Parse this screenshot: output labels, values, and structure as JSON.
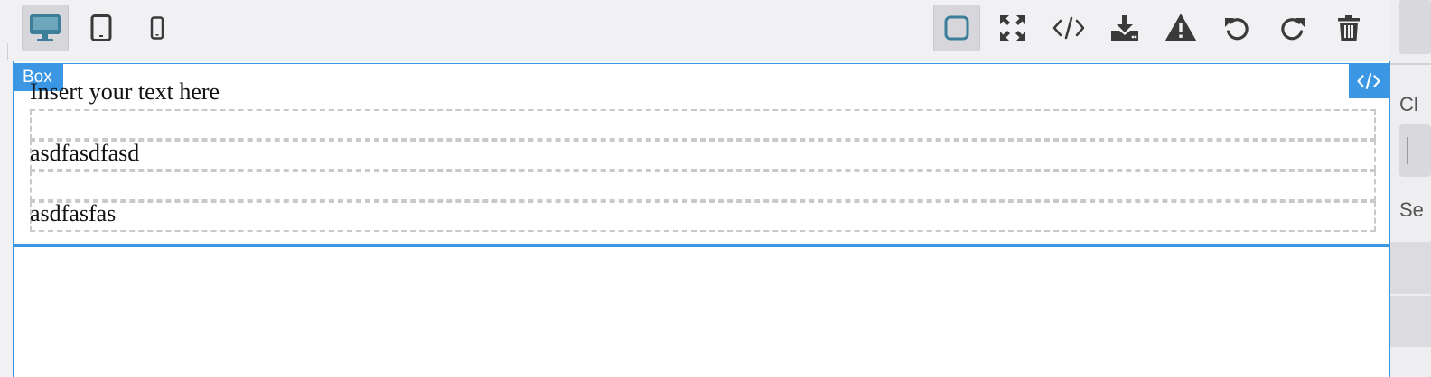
{
  "toolbar": {
    "device_buttons": [
      {
        "name": "desktop",
        "icon": "desktop-icon",
        "active": true
      },
      {
        "name": "tablet",
        "icon": "tablet-icon",
        "active": false
      },
      {
        "name": "mobile",
        "icon": "mobile-icon",
        "active": false
      }
    ],
    "action_buttons": [
      {
        "name": "sw-visibility",
        "icon": "square-icon",
        "active": true
      },
      {
        "name": "fullscreen",
        "icon": "expand-icon",
        "active": false
      },
      {
        "name": "view-code",
        "icon": "code-icon",
        "active": false
      },
      {
        "name": "export",
        "icon": "download-icon",
        "active": false
      },
      {
        "name": "warning",
        "icon": "warning-icon",
        "active": false
      },
      {
        "name": "undo",
        "icon": "undo-icon",
        "active": false
      },
      {
        "name": "redo",
        "icon": "redo-icon",
        "active": false
      },
      {
        "name": "delete",
        "icon": "trash-icon",
        "active": false
      }
    ]
  },
  "canvas": {
    "selected_label": "Box",
    "code_badge_icon": "code-icon",
    "text_lines": [
      "Insert your text here",
      "asdfasdfasd",
      "asdfasfas"
    ]
  },
  "right_panel": {
    "label_1": "Cl",
    "label_2": "Se"
  },
  "colors": {
    "accent": "#3b97e3",
    "toolbar_bg": "#f1f0f2",
    "icon_color": "#3a3a3a",
    "active_icon_color": "#3b7f9a"
  }
}
